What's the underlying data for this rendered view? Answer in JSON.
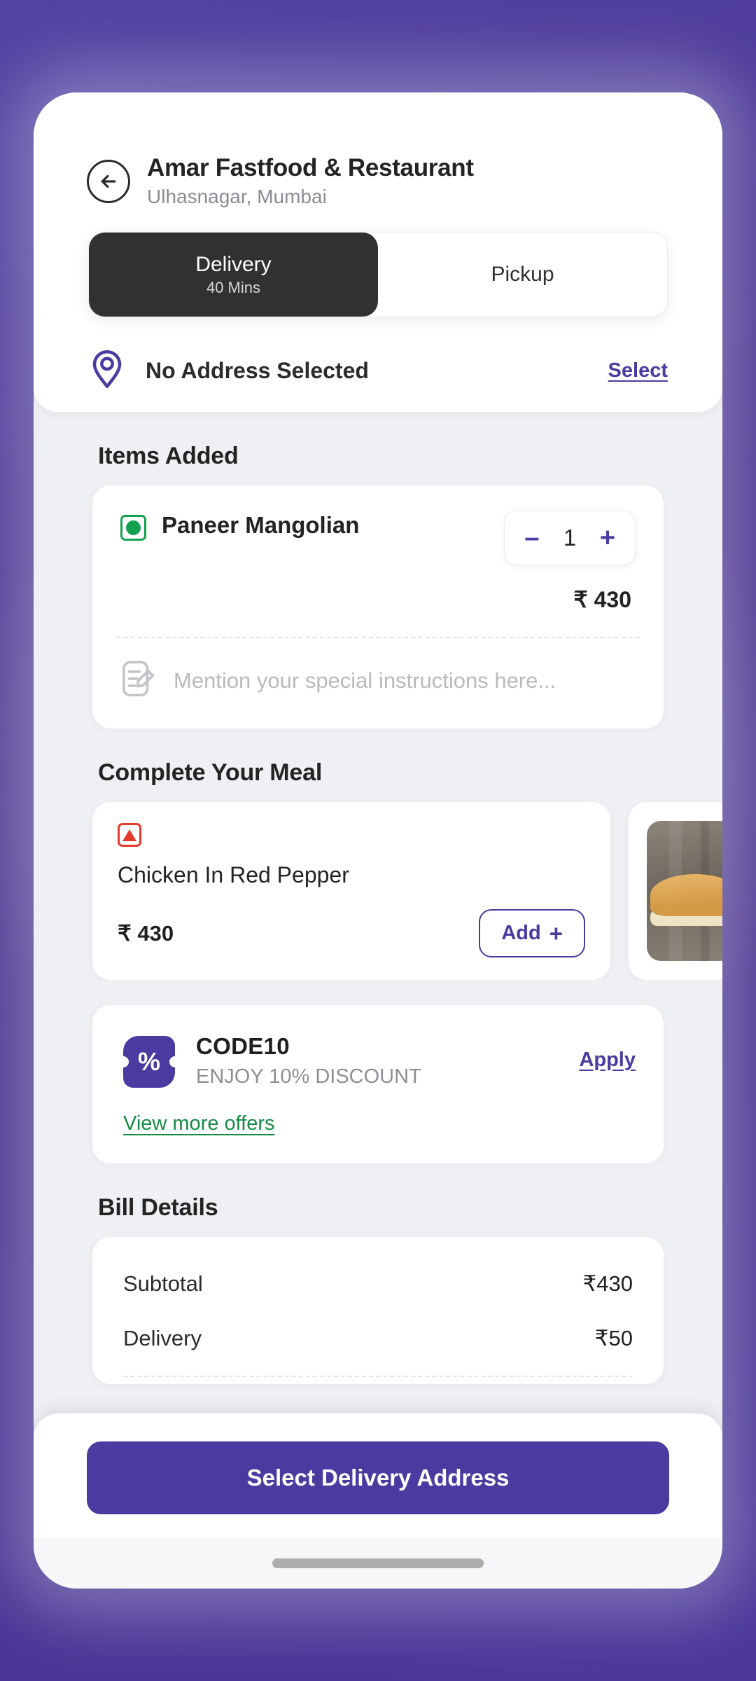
{
  "theme": {
    "background_purple": "#4a3490",
    "accent_purple": "#4b3aa0",
    "veg_green": "#12a150",
    "nonveg_red": "#e23b2e",
    "offers_green": "#168a46",
    "dark_pill": "#313131"
  },
  "header": {
    "back_icon": "arrow-left-icon",
    "title": "Amar Fastfood & Restaurant",
    "subtitle": "Ulhasnagar, Mumbai"
  },
  "mode_toggle": {
    "options": [
      {
        "label": "Delivery",
        "sub": "40 Mins",
        "selected": true
      },
      {
        "label": "Pickup",
        "sub": "",
        "selected": false
      }
    ]
  },
  "address": {
    "icon": "location-pin-icon",
    "text": "No Address Selected",
    "action_label": "Select"
  },
  "items_added": {
    "section_title": "Items Added",
    "item": {
      "diet_icon": "veg-icon",
      "name": "Paneer Mangolian",
      "quantity": "1",
      "decrement_label": "–",
      "increment_label": "+",
      "price": "₹ 430"
    },
    "instructions": {
      "icon": "note-edit-icon",
      "placeholder": "Mention your special instructions here..."
    }
  },
  "complete_meal": {
    "section_title": "Complete Your Meal",
    "cards": [
      {
        "diet_icon": "nonveg-icon",
        "name": "Chicken In Red Pepper",
        "price": "₹ 430",
        "add_label": "Add",
        "add_plus": "+"
      }
    ],
    "peek_card": {
      "image": "sandwich-photo"
    }
  },
  "offer": {
    "icon": "percent-coupon-icon",
    "code": "CODE10",
    "description": "ENJOY 10% DISCOUNT",
    "apply_label": "Apply",
    "view_more_label": "View more offers",
    "percent_glyph": "%"
  },
  "bill": {
    "section_title": "Bill Details",
    "rows": [
      {
        "label": "Subtotal",
        "value": "₹430"
      },
      {
        "label": "Delivery",
        "value": "₹50"
      }
    ]
  },
  "cta": {
    "label": "Select Delivery Address"
  }
}
